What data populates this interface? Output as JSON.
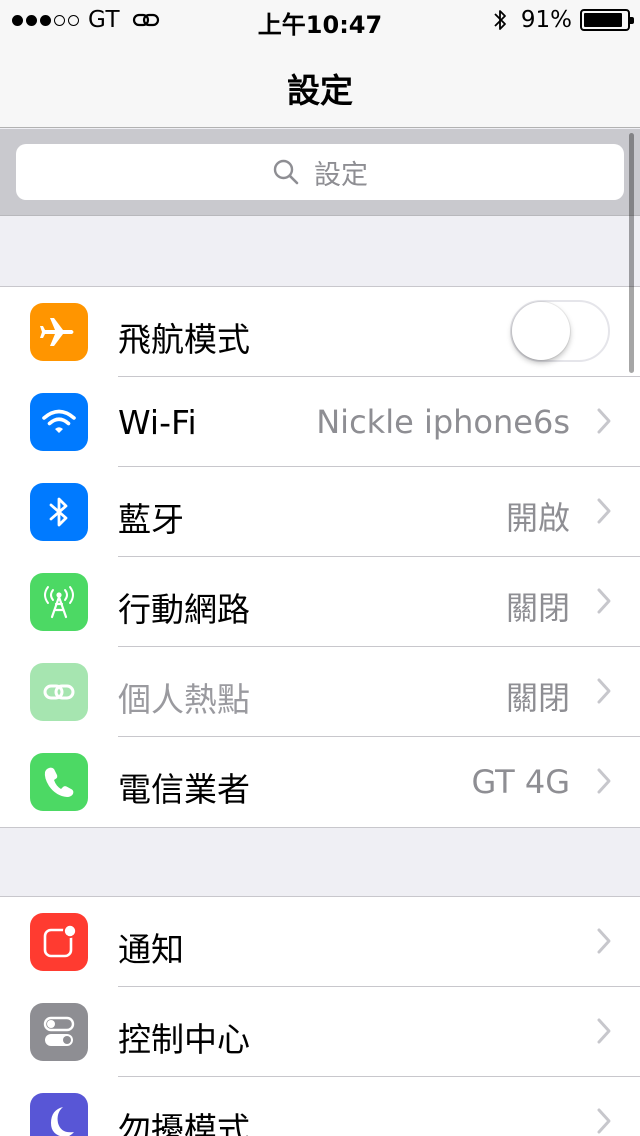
{
  "status_bar": {
    "carrier": "GT",
    "time": "上午10:47",
    "battery_percent": "91%",
    "battery_level": 0.91,
    "signal_bars_filled": 3,
    "signal_bars_total": 5
  },
  "nav": {
    "title": "設定"
  },
  "search": {
    "placeholder": "設定"
  },
  "groups": [
    {
      "rows": [
        {
          "label": "飛航模式",
          "icon": "airplane-icon",
          "icon_color": "#ff9500",
          "control": "toggle",
          "toggle_on": false
        },
        {
          "label": "Wi-Fi",
          "value": "Nickle iphone6s",
          "icon": "wifi-icon",
          "icon_color": "#007aff"
        },
        {
          "label": "藍牙",
          "value": "開啟",
          "icon": "bluetooth-icon",
          "icon_color": "#007aff"
        },
        {
          "label": "行動網路",
          "value": "關閉",
          "icon": "cellular-antenna-icon",
          "icon_color": "#4cd964"
        },
        {
          "label": "個人熱點",
          "value": "關閉",
          "icon": "hotspot-icon",
          "icon_color": "#a6e5b0",
          "dimmed": true
        },
        {
          "label": "電信業者",
          "value": "GT 4G",
          "icon": "phone-icon",
          "icon_color": "#4cd964"
        }
      ]
    },
    {
      "rows": [
        {
          "label": "通知",
          "icon": "notifications-icon",
          "icon_color": "#ff3b30"
        },
        {
          "label": "控制中心",
          "icon": "control-center-icon",
          "icon_color": "#8e8e93"
        },
        {
          "label": "勿擾模式",
          "icon": "moon-icon",
          "icon_color": "#5856d6"
        }
      ]
    }
  ]
}
